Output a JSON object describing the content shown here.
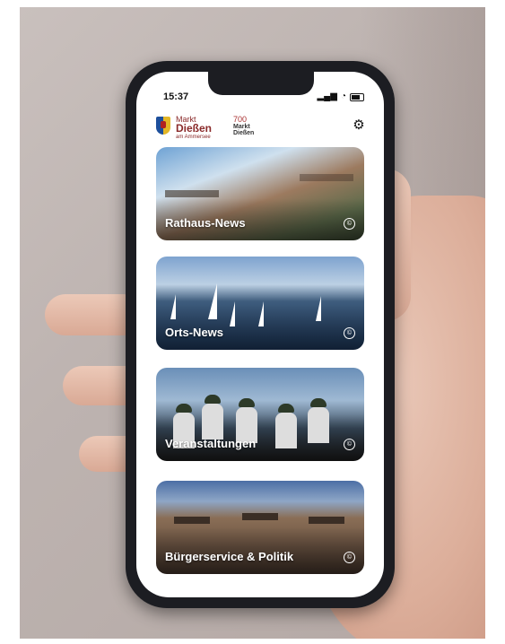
{
  "status": {
    "time": "15:37",
    "signal": "▂▄▆",
    "wifi": "◔"
  },
  "header": {
    "logo_line1": "Markt",
    "logo_line2": "Dießen",
    "logo_line3": "am Ammersee",
    "jubilee_number": "700",
    "jubilee_line1": "Markt",
    "jubilee_line2": "Dießen",
    "settings_icon": "gear-icon"
  },
  "cards": [
    {
      "label": "Rathaus-News",
      "copyright": "©"
    },
    {
      "label": "Orts-News",
      "copyright": "©"
    },
    {
      "label": "Veranstaltungen",
      "copyright": "©"
    },
    {
      "label": "Bürgerservice & Politik",
      "copyright": "©"
    }
  ],
  "colors": {
    "phone_frame": "#1c1d22",
    "logo_red": "#8a2a2a",
    "background_wall": "#c0b6b3"
  }
}
